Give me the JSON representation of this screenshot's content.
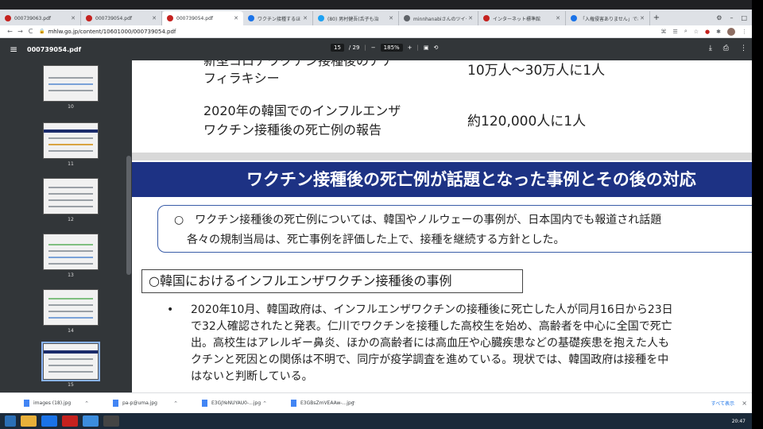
{
  "tabs": [
    {
      "title": "000739063.pdf",
      "color": "#c5221f",
      "active": false
    },
    {
      "title": "000739054.pdf",
      "color": "#c5221f",
      "active": false
    },
    {
      "title": "000739054.pdf",
      "color": "#c5221f",
      "active": true
    },
    {
      "title": "ワクチン接種するほど感染が拡大",
      "color": "#1a73e8",
      "active": false
    },
    {
      "title": "(80) 男村健吾(舌子も治",
      "color": "#1da1f2",
      "active": false
    },
    {
      "title": "minnhanabiさんのツイー",
      "color": "#1da1f2",
      "active": false
    },
    {
      "title": "インターネット標準館",
      "color": "#c5221f",
      "active": false
    },
    {
      "title": "「入権侵害ありません」でお",
      "color": "#1a73e8",
      "active": false
    }
  ],
  "toolbar": {
    "url": "mhlw.go.jp/content/10601000/000739054.pdf",
    "back": "←",
    "forward": "→",
    "reload": "C"
  },
  "pdf": {
    "menu": "≡",
    "filename": "000739054.pdf",
    "page_current": "15",
    "page_total": "/ 29",
    "zoom_minus": "−",
    "zoom": "185%",
    "zoom_plus": "+",
    "download": "⤓",
    "print": "⎙",
    "more": "⋮"
  },
  "thumbnails": [
    {
      "label": "10",
      "selected": false
    },
    {
      "label": "11",
      "selected": false
    },
    {
      "label": "12",
      "selected": false
    },
    {
      "label": "13",
      "selected": false
    },
    {
      "label": "14",
      "selected": false
    },
    {
      "label": "15",
      "selected": true
    }
  ],
  "page": {
    "row1_line1": "新型コロナワクチン接種後のアナ",
    "row1_line2": "フィラキシー",
    "row1_value": "10万人〜30万人に1人",
    "row2_line1": "2020年の韓国でのインフルエンザ",
    "row2_line2": "ワクチン接種後の死亡例の報告",
    "row2_value": "約120,000人に1人",
    "banner": "ワクチン接種後の死亡例が話題となった事例とその後の対応",
    "note_line1": "○　ワクチン接種後の死亡例については、韓国やノルウェーの事例が、日本国内でも報道され話題",
    "note_line2": "各々の規制当局は、死亡事例を評価した上で、接種を継続する方針とした。",
    "heading": "○韓国におけるインフルエンザワクチン接種後の事例",
    "bullet": "•",
    "body_lines": [
      "2020年10月、韓国政府は、インフルエンザワクチンの接種後に死亡した人が同月16日から23日",
      "で32人確認されたと発表。仁川でワクチンを接種した高校生を始め、高齢者を中心に全国で死亡",
      "出。高校生はアレルギー鼻炎、ほかの高齢者には高血圧や心臓疾患などの基礎疾患を抱えた人も",
      "クチンと死因との関係は不明で、同庁が疫学調査を進めている。現状では、韓国政府は接種を中",
      "はないと判断している。"
    ]
  },
  "downloads": [
    {
      "name": "images (18).jpg"
    },
    {
      "name": "pa-p@uma.jpg"
    },
    {
      "name": "E3GJYeNUYAU0-...jpg"
    },
    {
      "name": "E3GBsZmVEAAw-...jpg"
    }
  ],
  "download_bar": {
    "show_all": "すべて表示",
    "close": "×"
  },
  "taskbar": {
    "time": "20:47"
  }
}
